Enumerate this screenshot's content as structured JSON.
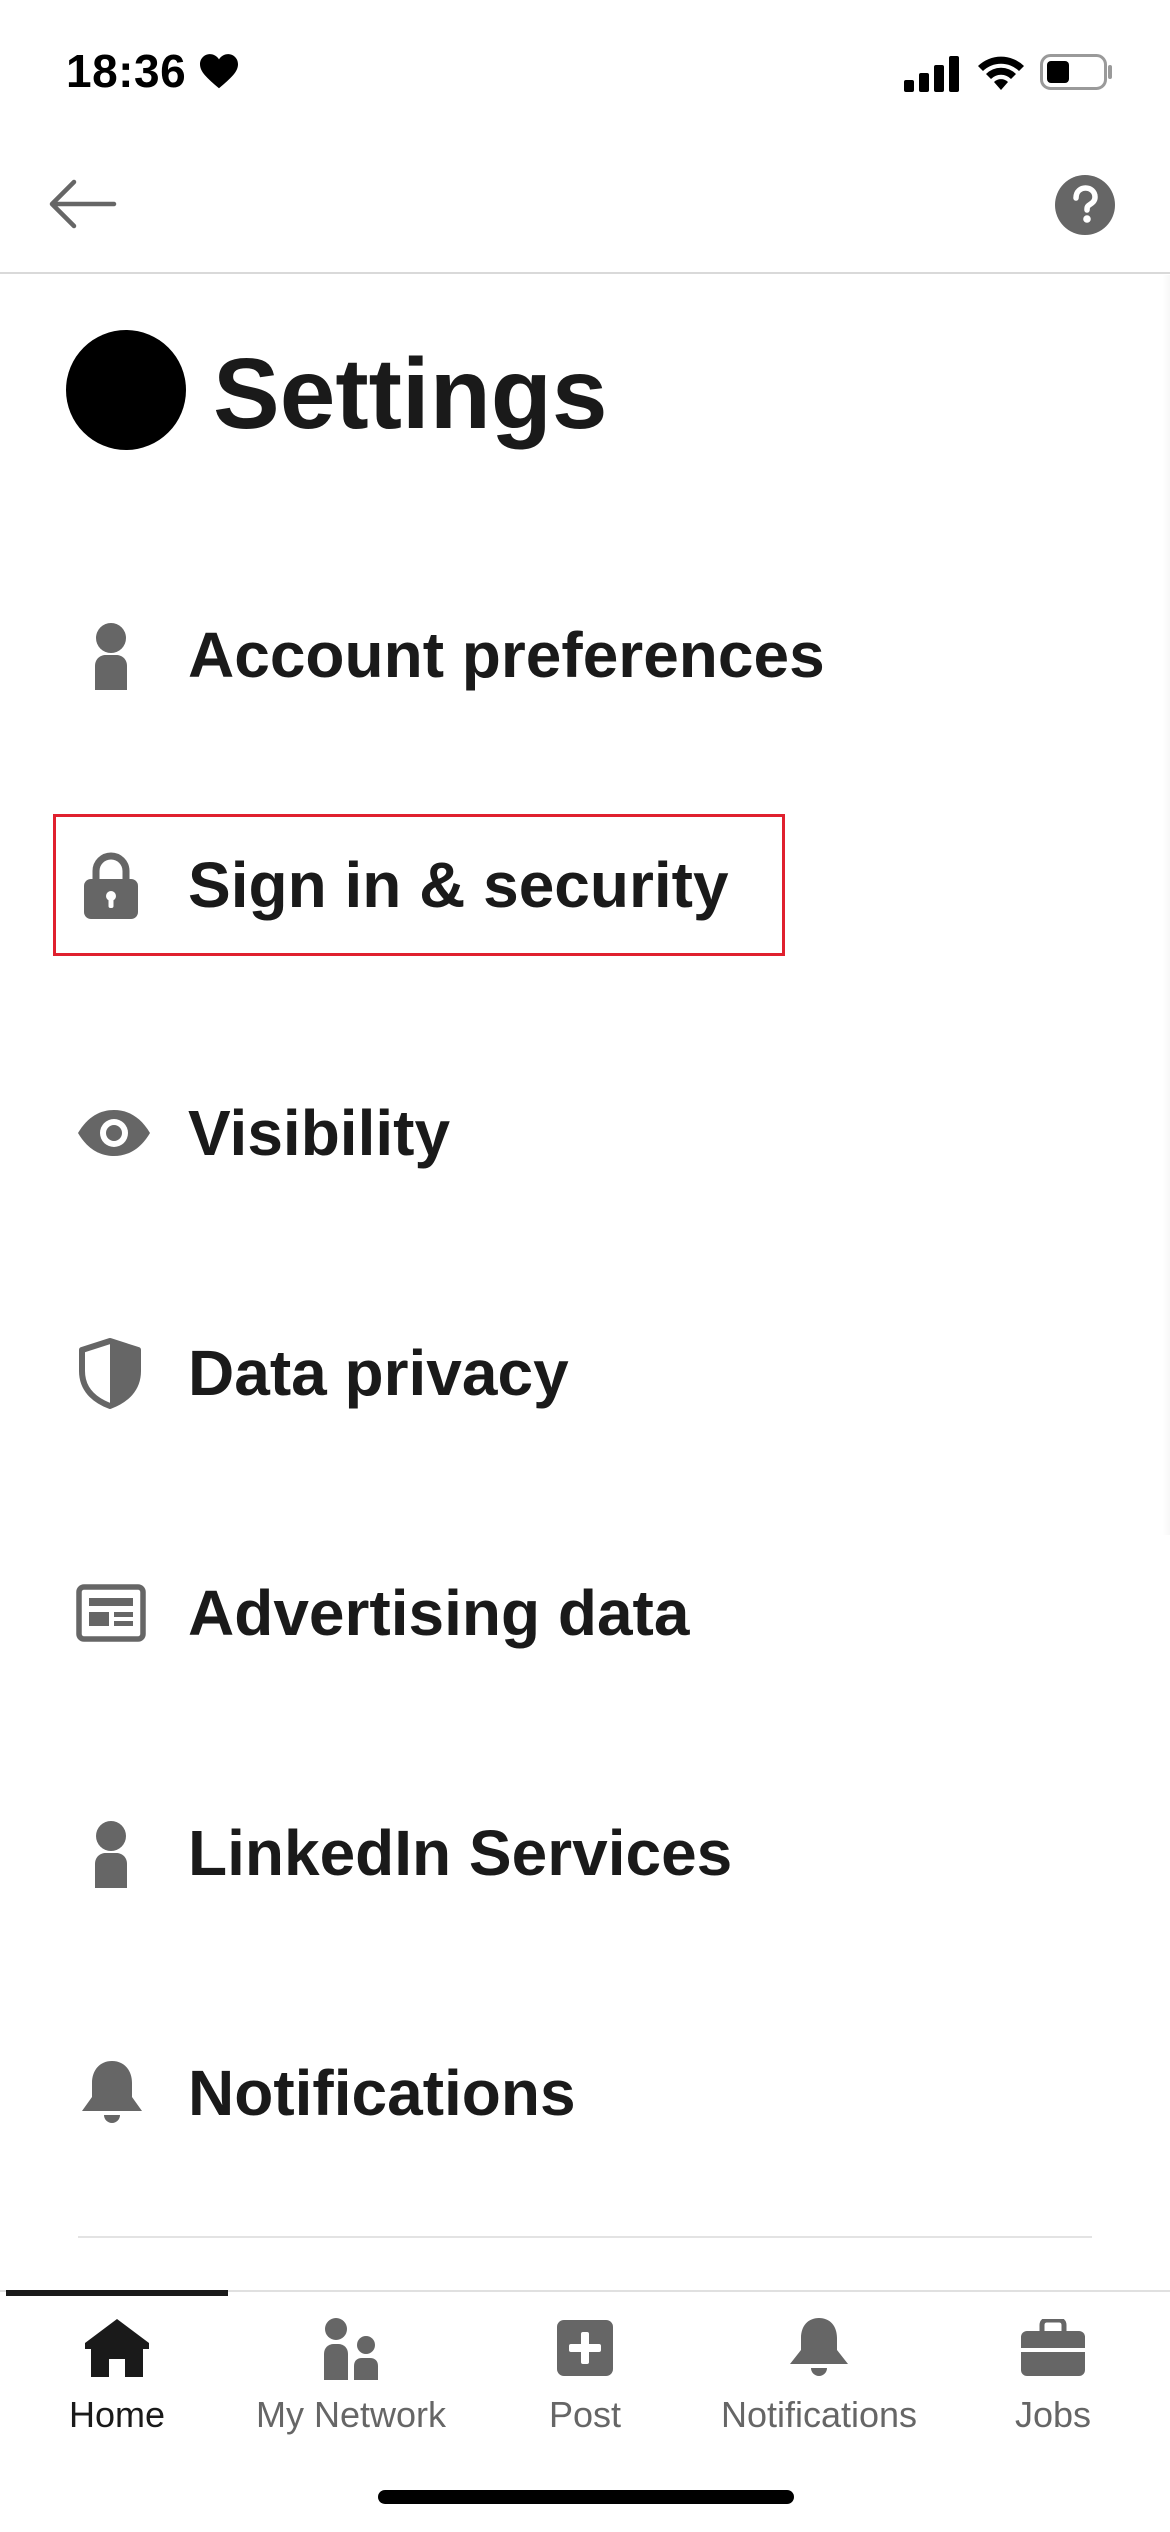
{
  "status_bar": {
    "time": "18:36",
    "heart_icon": "heart-icon",
    "signal_icon": "cellular-signal-icon",
    "wifi_icon": "wifi-icon",
    "battery_icon": "battery-icon"
  },
  "nav": {
    "back_icon": "arrow-left-icon",
    "help_icon": "question-circle-icon"
  },
  "page": {
    "title": "Settings"
  },
  "menu": {
    "items": [
      {
        "label": "Account preferences",
        "icon": "person-icon"
      },
      {
        "label": "Sign in & security",
        "icon": "lock-icon",
        "highlighted": true
      },
      {
        "label": "Visibility",
        "icon": "eye-icon"
      },
      {
        "label": "Data privacy",
        "icon": "shield-icon"
      },
      {
        "label": "Advertising data",
        "icon": "newspaper-icon"
      },
      {
        "label": "LinkedIn Services",
        "icon": "person-icon"
      },
      {
        "label": "Notifications",
        "icon": "bell-icon"
      }
    ]
  },
  "tabs": [
    {
      "label": "Home",
      "icon": "home-icon",
      "active": true
    },
    {
      "label": "My Network",
      "icon": "people-icon",
      "active": false
    },
    {
      "label": "Post",
      "icon": "plus-square-icon",
      "active": false
    },
    {
      "label": "Notifications",
      "icon": "bell-icon",
      "active": false
    },
    {
      "label": "Jobs",
      "icon": "briefcase-icon",
      "active": false
    }
  ],
  "colors": {
    "text": "#1a1a1a",
    "icon_gray": "#666666",
    "highlight_red": "#e0202e"
  }
}
